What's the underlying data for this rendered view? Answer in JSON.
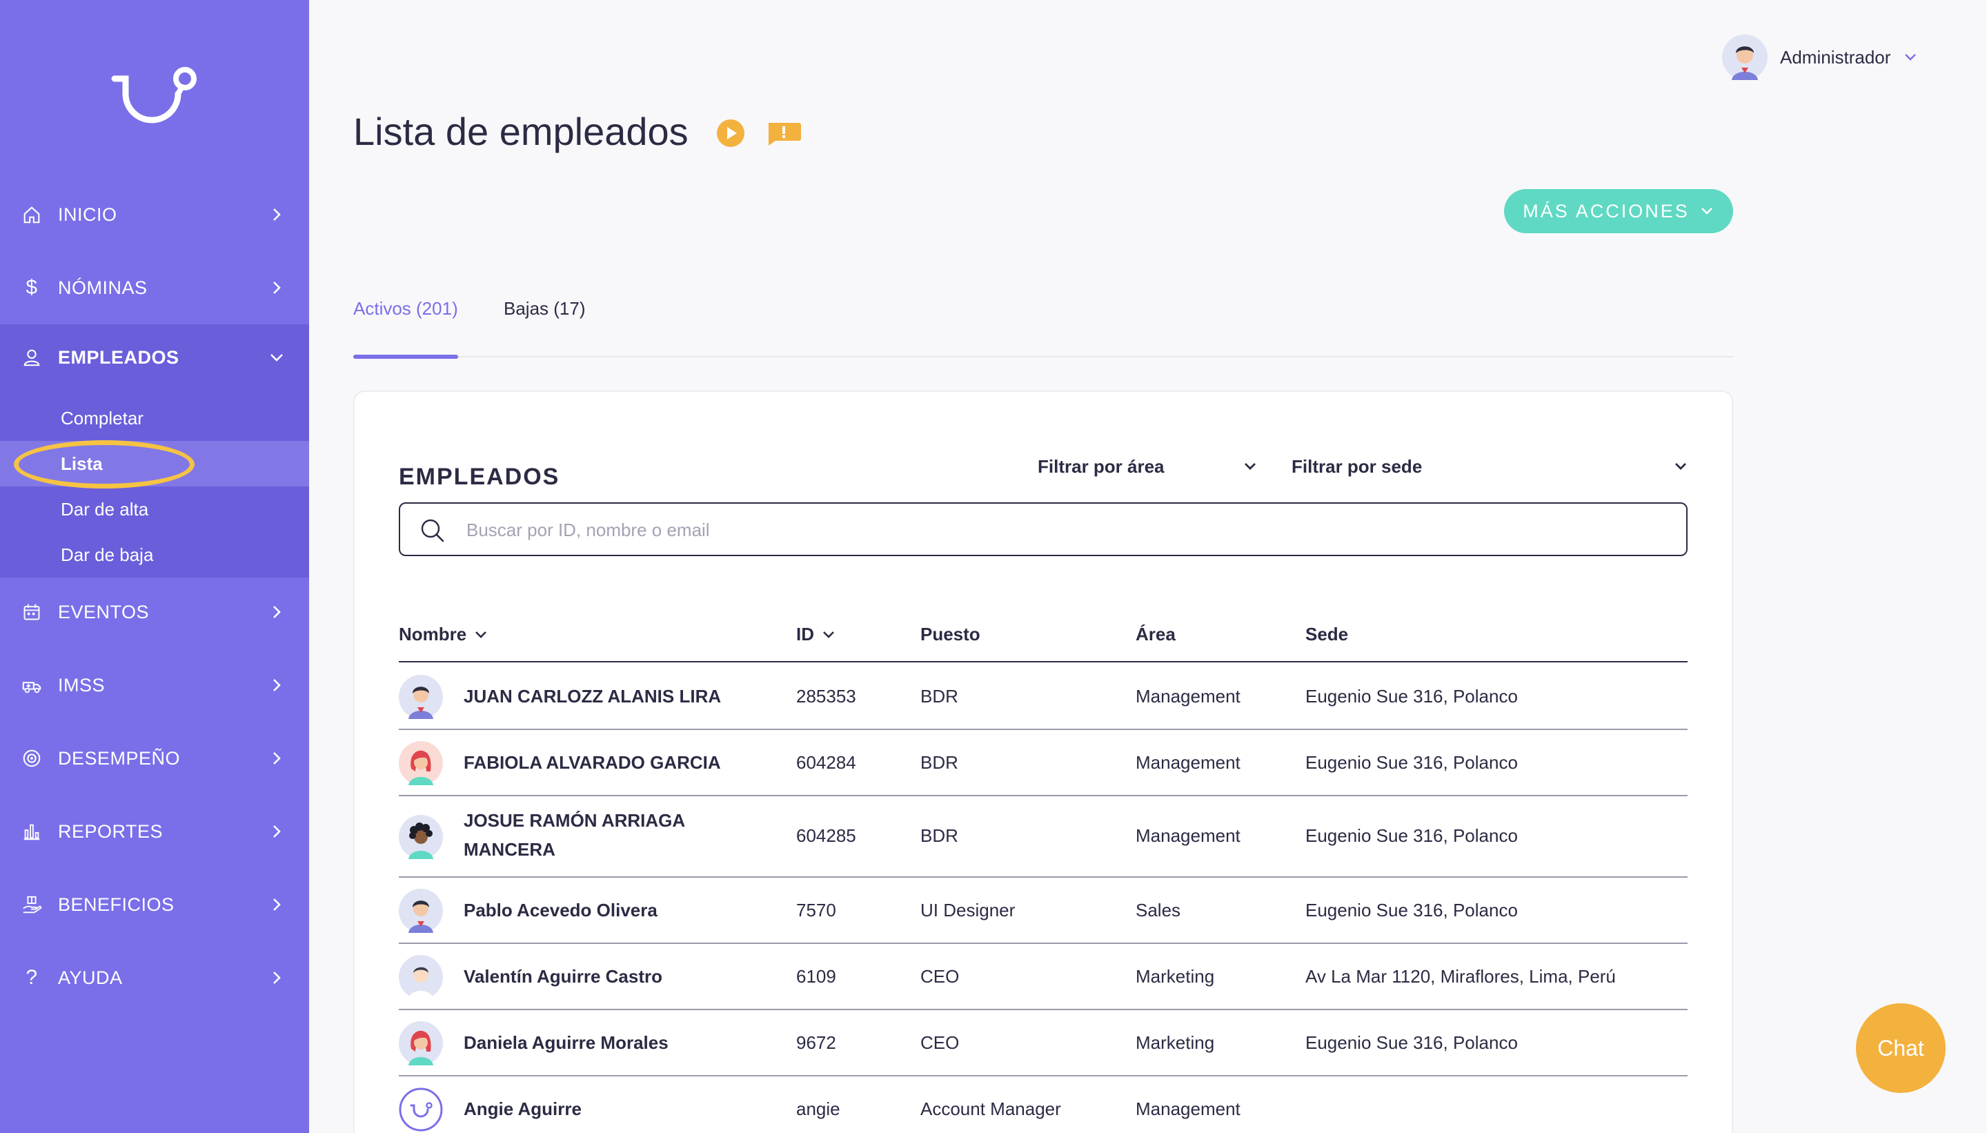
{
  "sidebar": {
    "logo_icon": "brand-logo",
    "items": [
      {
        "label": "INICIO",
        "icon": "home-icon"
      },
      {
        "label": "NÓMINAS",
        "icon": "dollar-icon"
      },
      {
        "label": "EMPLEADOS",
        "icon": "user-icon"
      },
      {
        "label": "EVENTOS",
        "icon": "calendar-icon"
      },
      {
        "label": "IMSS",
        "icon": "ambulance-icon"
      },
      {
        "label": "DESEMPEÑO",
        "icon": "target-icon"
      },
      {
        "label": "REPORTES",
        "icon": "bar-chart-icon"
      },
      {
        "label": "BENEFICIOS",
        "icon": "gift-hand-icon"
      },
      {
        "label": "AYUDA",
        "icon": "question-icon"
      }
    ],
    "subitems": [
      {
        "label": "Completar"
      },
      {
        "label": "Lista"
      },
      {
        "label": "Dar de alta"
      },
      {
        "label": "Dar de baja"
      }
    ]
  },
  "header": {
    "user_name": "Administrador"
  },
  "page": {
    "title": "Lista de empleados",
    "more_actions_label": "MÁS ACCIONES"
  },
  "tabs": [
    {
      "label": "Activos (201)"
    },
    {
      "label": "Bajas (17)"
    }
  ],
  "card": {
    "title": "EMPLEADOS",
    "filter_area": "Filtrar por área",
    "filter_sede": "Filtrar por sede",
    "search_placeholder": "Buscar por ID, nombre o email",
    "search_value": ""
  },
  "table": {
    "columns": [
      "Nombre",
      "ID",
      "Puesto",
      "Área",
      "Sede"
    ],
    "rows": [
      {
        "name": "JUAN CARLOZZ ALANIS LIRA",
        "id": "285353",
        "puesto": "BDR",
        "area": "Management",
        "sede": "Eugenio Sue 316, Polanco",
        "avatar": "male-avatar-icon"
      },
      {
        "name": "FABIOLA ALVARADO GARCIA",
        "id": "604284",
        "puesto": "BDR",
        "area": "Management",
        "sede": "Eugenio Sue 316, Polanco",
        "avatar": "female-redhair-avatar-icon"
      },
      {
        "name": "JOSUE RAMÓN ARRIAGA MANCERA",
        "id": "604285",
        "puesto": "BDR",
        "area": "Management",
        "sede": "Eugenio Sue 316, Polanco",
        "avatar": "curly-hair-avatar-icon"
      },
      {
        "name": "Pablo Acevedo Olivera",
        "id": "7570",
        "puesto": "UI Designer",
        "area": "Sales",
        "sede": "Eugenio Sue 316, Polanco",
        "avatar": "male-avatar-icon"
      },
      {
        "name": "Valentín Aguirre Castro",
        "id": "6109",
        "puesto": "CEO",
        "area": "Marketing",
        "sede": "Av La Mar 1120, Miraflores, Lima, Perú",
        "avatar": "male-light-avatar-icon"
      },
      {
        "name": "Daniela Aguirre Morales",
        "id": "9672",
        "puesto": "CEO",
        "area": "Marketing",
        "sede": "Eugenio Sue 316, Polanco",
        "avatar": "female-redhair-avatar-icon"
      },
      {
        "name": "Angie Aguirre",
        "id": "angie",
        "puesto": "Account Manager",
        "area": "Management",
        "sede": "",
        "avatar": "brand-logo-avatar-icon"
      }
    ]
  },
  "chat": {
    "label": "Chat"
  },
  "colors": {
    "sidebar": "#7a6fe8",
    "sidebar_active": "#6a5edb",
    "accent": "#7a6fe8",
    "teal_button": "#5fd9c3",
    "orange": "#f3b13e",
    "highlight": "#f6c343"
  }
}
